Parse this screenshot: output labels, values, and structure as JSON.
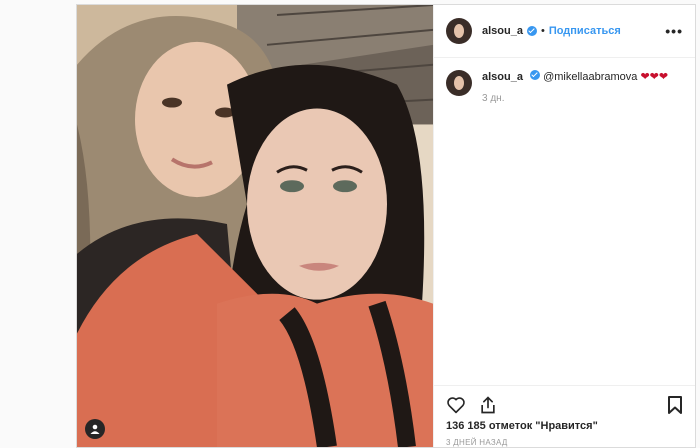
{
  "post": {
    "username": "alsou_a",
    "follow_label": "Подписаться",
    "dot": "•",
    "more": "•••",
    "caption": {
      "username": "alsou_a",
      "mention": "@mikellaabramova",
      "hearts": "❤❤❤",
      "age": "3 дн."
    },
    "likes": "136 185 отметок \"Нравится\"",
    "timestamp": "3 дней назад"
  },
  "icons": {
    "heart": "heart-icon",
    "share": "share-icon",
    "bookmark": "bookmark-icon",
    "user_tag": "user-tag-icon",
    "verified": "verified-badge-icon",
    "more": "more-options-icon"
  },
  "colors": {
    "accent": "#3897f0",
    "text": "#262626",
    "muted": "#999999",
    "heart": "#c8102e"
  }
}
